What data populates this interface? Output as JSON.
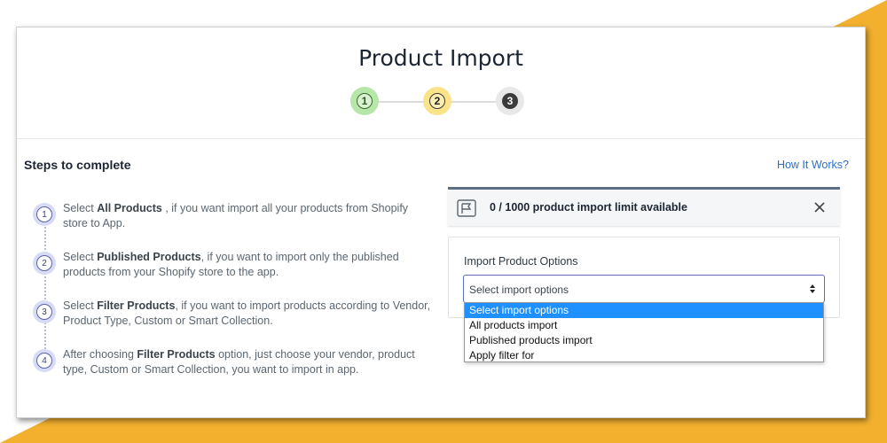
{
  "page": {
    "title": "Product Import"
  },
  "stepper": {
    "steps": [
      "1",
      "2",
      "3"
    ]
  },
  "steps_section": {
    "heading": "Steps to complete",
    "how_link": "How It Works?",
    "items": [
      {
        "num": "1",
        "pre": "Select ",
        "bold": "All Products",
        "post": " , if you want import all your products from Shopify store to App."
      },
      {
        "num": "2",
        "pre": "Select ",
        "bold": "Published Products",
        "post": ", if you want to import only the published products from your Shopify store to the app."
      },
      {
        "num": "3",
        "pre": "Select ",
        "bold": "Filter Products",
        "post": ", if you want to import products according to Vendor, Product Type, Custom or Smart Collection."
      },
      {
        "num": "4",
        "pre": "After choosing ",
        "bold": "Filter Products",
        "post": " option, just choose your vendor, product type, Custom or Smart Collection, you want to import in app."
      }
    ]
  },
  "limit_banner": {
    "text": "0 / 1000 product import limit available",
    "icon": "flag-icon",
    "close_icon": "close-icon"
  },
  "import_options": {
    "label": "Import Product Options",
    "selected": "Select import options",
    "options": [
      "Select import options",
      "All products import",
      "Published products import",
      "Apply filter for"
    ]
  },
  "colors": {
    "background": "#f2b02e",
    "accent": "#5c6ac4",
    "link": "#2c6ecb",
    "dropdown_highlight": "#1e90ff"
  }
}
